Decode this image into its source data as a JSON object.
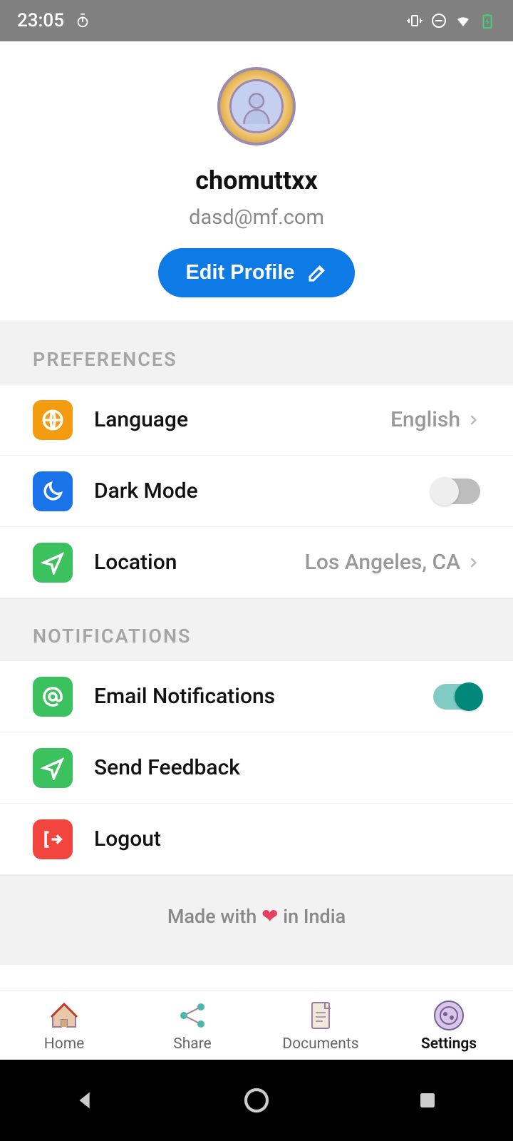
{
  "statusbar": {
    "time": "23:05"
  },
  "profile": {
    "username": "chomuttxx",
    "email": "dasd@mf.com",
    "edit_button": "Edit Profile"
  },
  "sections": {
    "preferences": {
      "title": "PREFERENCES",
      "language": {
        "label": "Language",
        "value": "English"
      },
      "dark_mode": {
        "label": "Dark Mode",
        "enabled": false
      },
      "location": {
        "label": "Location",
        "value": "Los Angeles, CA"
      }
    },
    "notifications": {
      "title": "NOTIFICATIONS",
      "email": {
        "label": "Email Notifications",
        "enabled": true
      },
      "feedback": {
        "label": "Send Feedback"
      },
      "logout": {
        "label": "Logout"
      }
    }
  },
  "footer": {
    "prefix": "Made with ",
    "suffix": " in India"
  },
  "tabs": {
    "home": "Home",
    "share": "Share",
    "documents": "Documents",
    "settings": "Settings",
    "active": "settings"
  }
}
